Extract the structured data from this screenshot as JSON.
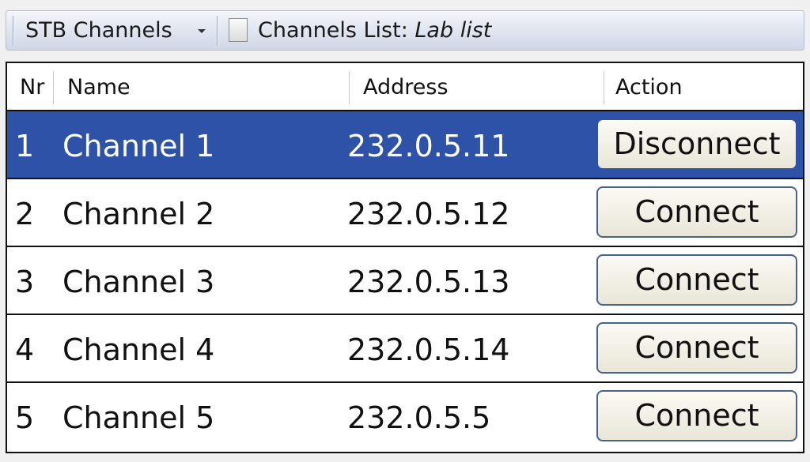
{
  "toolbar": {
    "menu_label": "STB Channels",
    "list_label": "Channels List:",
    "list_name": "Lab list"
  },
  "table": {
    "columns": [
      "Nr",
      "Name",
      "Address",
      "Action"
    ],
    "rows": [
      {
        "nr": "1",
        "name": "Channel 1",
        "address": "232.0.5.11",
        "action": "Disconnect",
        "selected": true
      },
      {
        "nr": "2",
        "name": "Channel 2",
        "address": "232.0.5.12",
        "action": "Connect",
        "selected": false
      },
      {
        "nr": "3",
        "name": "Channel 3",
        "address": "232.0.5.13",
        "action": "Connect",
        "selected": false
      },
      {
        "nr": "4",
        "name": "Channel 4",
        "address": "232.0.5.14",
        "action": "Connect",
        "selected": false
      },
      {
        "nr": "5",
        "name": "Channel 5",
        "address": "232.0.5.5",
        "action": "Connect",
        "selected": false
      }
    ]
  },
  "colors": {
    "selected_row": "#2d52a8",
    "button_border": "#46638f"
  }
}
